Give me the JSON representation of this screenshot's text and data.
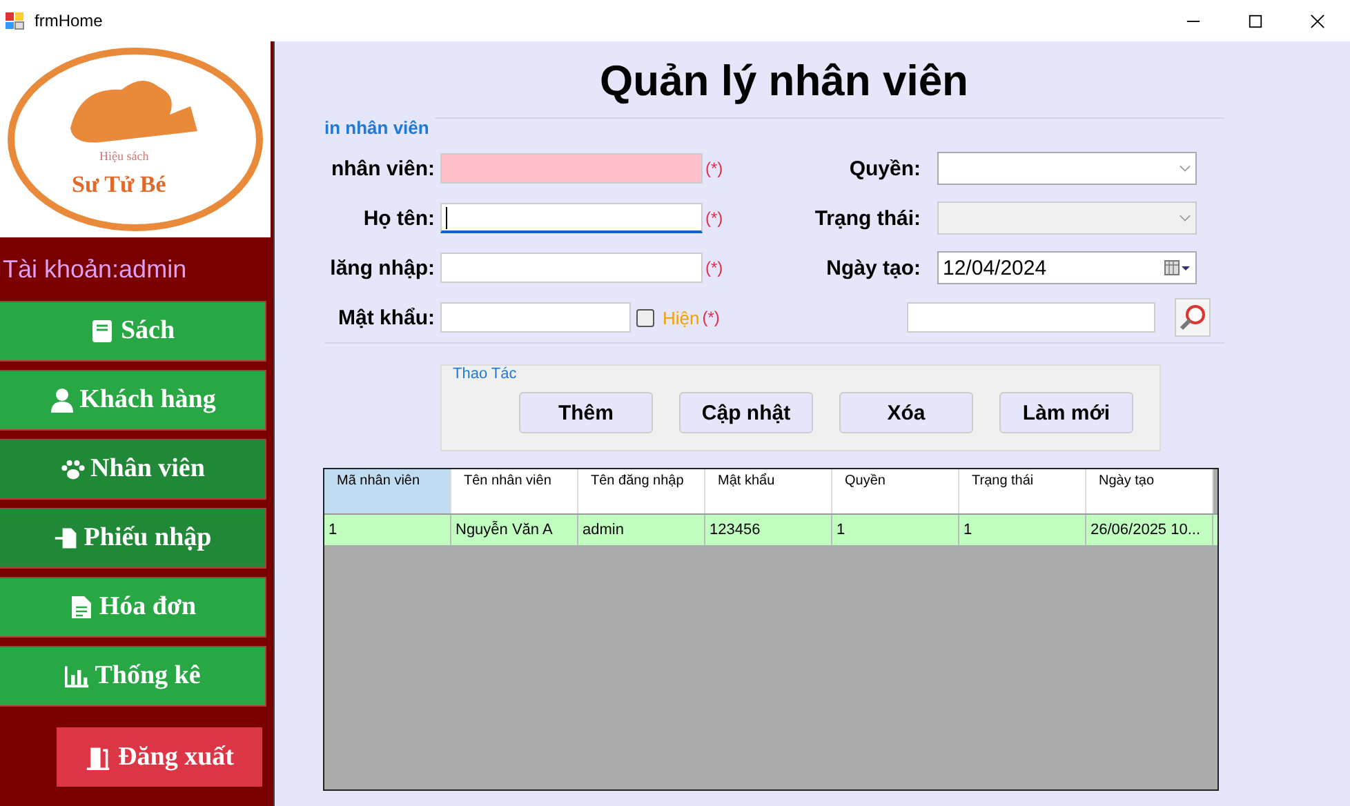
{
  "window": {
    "title": "frmHome"
  },
  "sidebar": {
    "logo": {
      "line_1": "Hiệu sách",
      "line_2": "Sư Tử Bé"
    },
    "account": "Tài khoản:admin",
    "items": [
      {
        "label": "Sách",
        "selected": false
      },
      {
        "label": "Khách hàng",
        "selected": false
      },
      {
        "label": "Nhân viên",
        "selected": true
      },
      {
        "label": "Phiếu nhập",
        "selected": true
      },
      {
        "label": "Hóa đơn",
        "selected": false
      },
      {
        "label": "Thống kê",
        "selected": false
      }
    ],
    "logout": "Đăng xuất"
  },
  "title": "Quản lý nhân viên",
  "info_group": {
    "legend": "in nhân viên",
    "left_fields": [
      {
        "label": "nhân viên:",
        "invalid": true,
        "focused": false,
        "required": "(*)"
      },
      {
        "label": "Họ tên:",
        "invalid": false,
        "focused": true,
        "required": "(*)"
      },
      {
        "label": "lăng nhập:",
        "invalid": false,
        "focused": false,
        "required": "(*)"
      }
    ],
    "password": {
      "label": "Mật khẩu:",
      "show_label": "Hiện",
      "show_checked": false,
      "required": "(*)"
    },
    "right_fields": [
      {
        "label": "Quyền:",
        "kind": "combo",
        "disabled": false
      },
      {
        "label": "Trạng thái:",
        "kind": "combo",
        "disabled": true
      },
      {
        "label": "Ngày tạo:",
        "kind": "date",
        "disabled": false,
        "value": "12/04/2024"
      }
    ]
  },
  "actions": {
    "legend": "Thao Tác",
    "buttons": [
      "Thêm",
      "Cập nhật",
      "Xóa",
      "Làm mới"
    ]
  },
  "table": {
    "columns": [
      {
        "label": "Mã nhân viên",
        "selected": true
      },
      {
        "label": "Tên nhân viên",
        "selected": false
      },
      {
        "label": "Tên đăng nhập",
        "selected": false
      },
      {
        "label": "Mật khẩu",
        "selected": false
      },
      {
        "label": "Quyền",
        "selected": false
      },
      {
        "label": "Trạng thái",
        "selected": false
      },
      {
        "label": "Ngày tạo",
        "selected": false
      }
    ],
    "rows": [
      {
        "selected": true,
        "cells": [
          "1",
          "Nguyễn Văn A",
          "admin",
          "123456",
          "1",
          "1",
          "26/06/2025 10..."
        ]
      }
    ]
  }
}
